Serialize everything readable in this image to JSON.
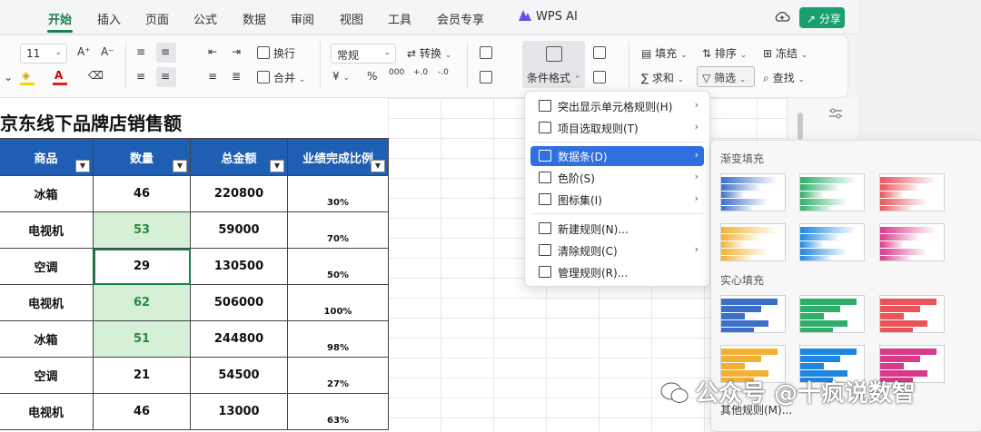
{
  "tabs": [
    "开始",
    "插入",
    "页面",
    "公式",
    "数据",
    "审阅",
    "视图",
    "工具",
    "会员专享"
  ],
  "active_tab": "开始",
  "wps_ai": "WPS AI",
  "share_label": "分享",
  "ribbon": {
    "font_size": "11",
    "line_wrap": "换行",
    "merge": "合并",
    "number_format": "常规",
    "convert": "转换",
    "conditional_format": "条件格式",
    "fill": "填充",
    "sort": "排序",
    "freeze": "冻结",
    "sum": "求和",
    "filter": "筛选",
    "find": "查找",
    "percent_sign": "%",
    "comma_sign": "000",
    "yen_sign": "¥"
  },
  "sheet": {
    "title": "京东线下品牌店销售额",
    "headers": [
      "商品",
      "数量",
      "总金额",
      "业绩完成比例"
    ],
    "rows": [
      {
        "product": "冰箱",
        "qty": "46",
        "amount": "220800",
        "pct": "30%",
        "green": false
      },
      {
        "product": "电视机",
        "qty": "53",
        "amount": "59000",
        "pct": "70%",
        "green": true
      },
      {
        "product": "空调",
        "qty": "29",
        "amount": "130500",
        "pct": "50%",
        "green": false
      },
      {
        "product": "电视机",
        "qty": "62",
        "amount": "506000",
        "pct": "100%",
        "green": true
      },
      {
        "product": "冰箱",
        "qty": "51",
        "amount": "244800",
        "pct": "98%",
        "green": true
      },
      {
        "product": "空调",
        "qty": "21",
        "amount": "54500",
        "pct": "27%",
        "green": false
      },
      {
        "product": "电视机",
        "qty": "46",
        "amount": "13000",
        "pct": "63%",
        "green": false
      }
    ]
  },
  "menu": {
    "items": [
      "突出显示单元格规则(H)",
      "项目选取规则(T)",
      "数据条(D)",
      "色阶(S)",
      "图标集(I)",
      "新建规则(N)...",
      "清除规则(C)",
      "管理规则(R)..."
    ],
    "active_item": "数据条(D)"
  },
  "submenu": {
    "gradient_label": "渐变填充",
    "solid_label": "实心填充",
    "more_rules": "其他规则(M)...",
    "colors": [
      "#3b6fc9",
      "#2fae6a",
      "#e8545a",
      "#f2b134",
      "#1f86e0",
      "#d83a8a"
    ]
  },
  "watermark": "公众号 @十疯说数智",
  "colors": {
    "accent": "#1a7f4b",
    "header_blue": "#1e5fb3",
    "highlight_green": "#d6f0d8",
    "menu_active": "#2f6fe0"
  }
}
